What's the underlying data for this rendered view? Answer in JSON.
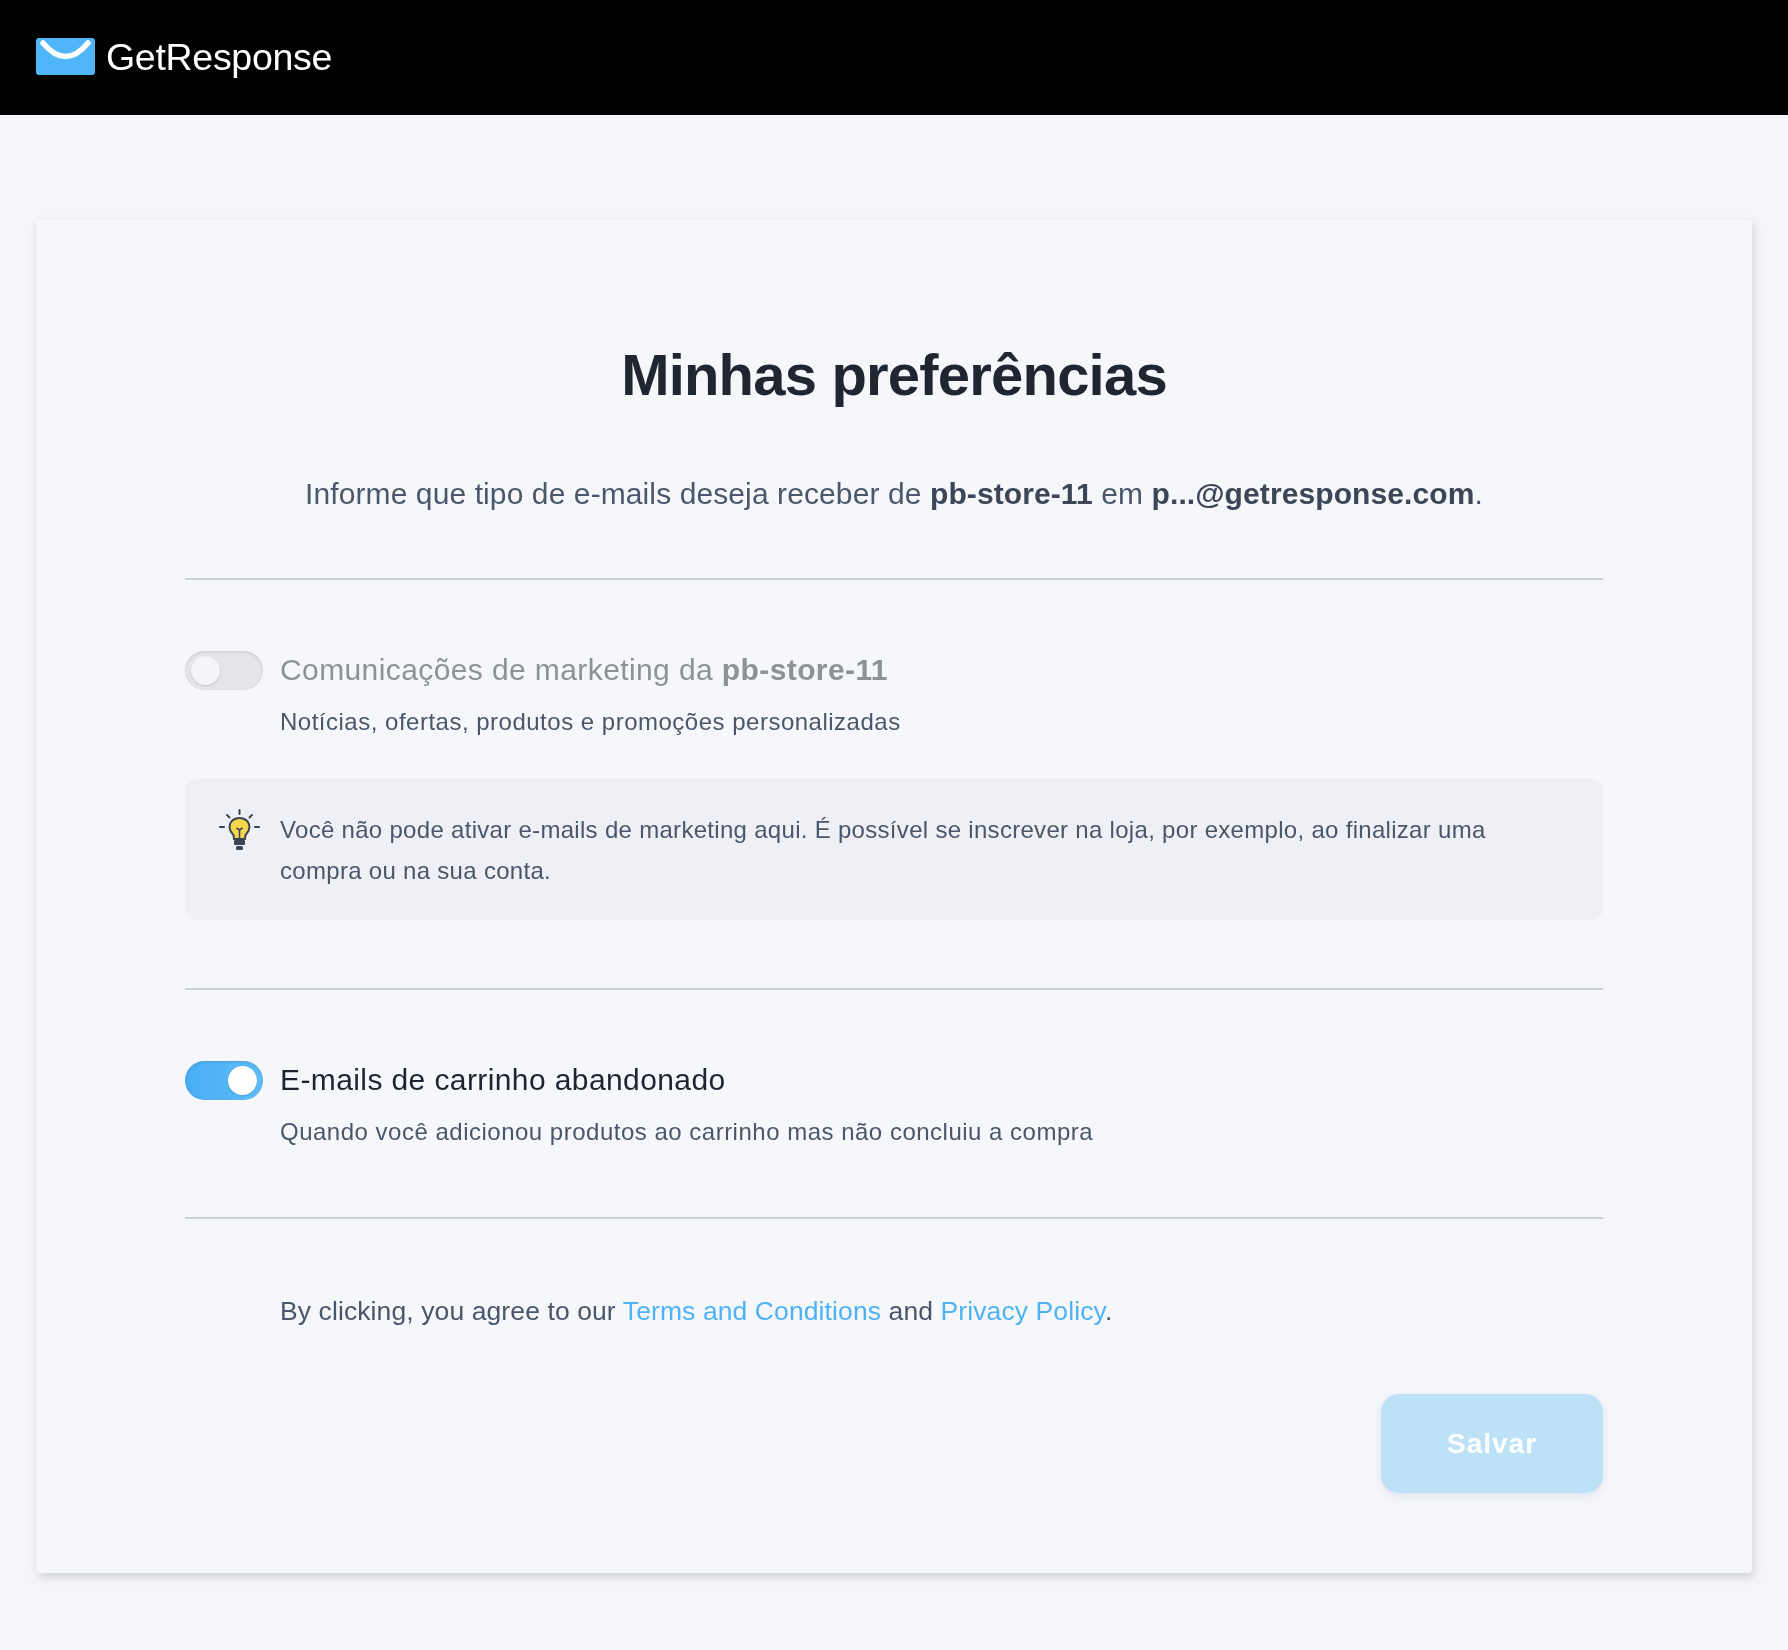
{
  "header": {
    "logo_text": "GetResponse"
  },
  "preferences": {
    "title": "Minhas preferências",
    "intro": "Informe que tipo de e-mails deseja receber de **pb-store-11** em **p...@getresponse.com**.",
    "options": [
      {
        "label": "Comunicações de marketing da **pb-store-11**",
        "description": "Notícias, ofertas, produtos e promoções personalizadas",
        "on": false,
        "disabled": true,
        "note": "Você não pode ativar e-mails de marketing aqui. É possível se inscrever na loja, por exemplo, ao finalizar uma compra ou na sua conta."
      },
      {
        "label": "E-mails de carrinho abandonado",
        "description": "Quando você adicionou produtos ao carrinho mas não concluiu a compra",
        "on": true,
        "disabled": false
      }
    ],
    "consent": [
      {
        "kind": "text",
        "text": "By clicking, you agree to our "
      },
      {
        "kind": "link",
        "text": "Terms and Conditions"
      },
      {
        "kind": "text",
        "text": " and "
      },
      {
        "kind": "link",
        "text": "Privacy Policy"
      },
      {
        "kind": "text",
        "text": "."
      }
    ],
    "save_button": {
      "label": "Salvar",
      "disabled": true
    }
  }
}
